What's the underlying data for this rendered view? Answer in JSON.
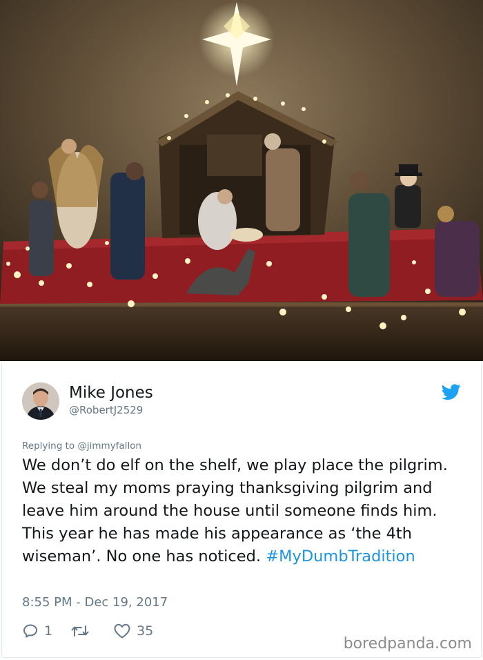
{
  "tweet": {
    "author_name": "Mike Jones",
    "author_handle": "@RobertJ2529",
    "replying_to": "Replying to @jimmyfallon",
    "text": "We don’t do elf on the shelf, we play place the pilgrim. We steal my moms praying thanksgiving pilgrim and leave him around the house until someone finds him. This year he has made his appearance as ‘the 4th wiseman’. No one has noticed. ",
    "hashtag": "#MyDumbTradition",
    "timestamp": "8:55 PM - Dec 19, 2017",
    "reply_count": "1",
    "retweet_count": "",
    "like_count": "35"
  },
  "icons": {
    "brand": "twitter-bird-icon",
    "reply": "reply-icon",
    "retweet": "retweet-icon",
    "like": "heart-icon"
  },
  "watermark": "boredpanda.com",
  "colors": {
    "twitter_blue": "#1da1f2",
    "hashtag": "#1b95e0",
    "secondary_text": "#657786",
    "table_runner": "#8f1d22"
  }
}
